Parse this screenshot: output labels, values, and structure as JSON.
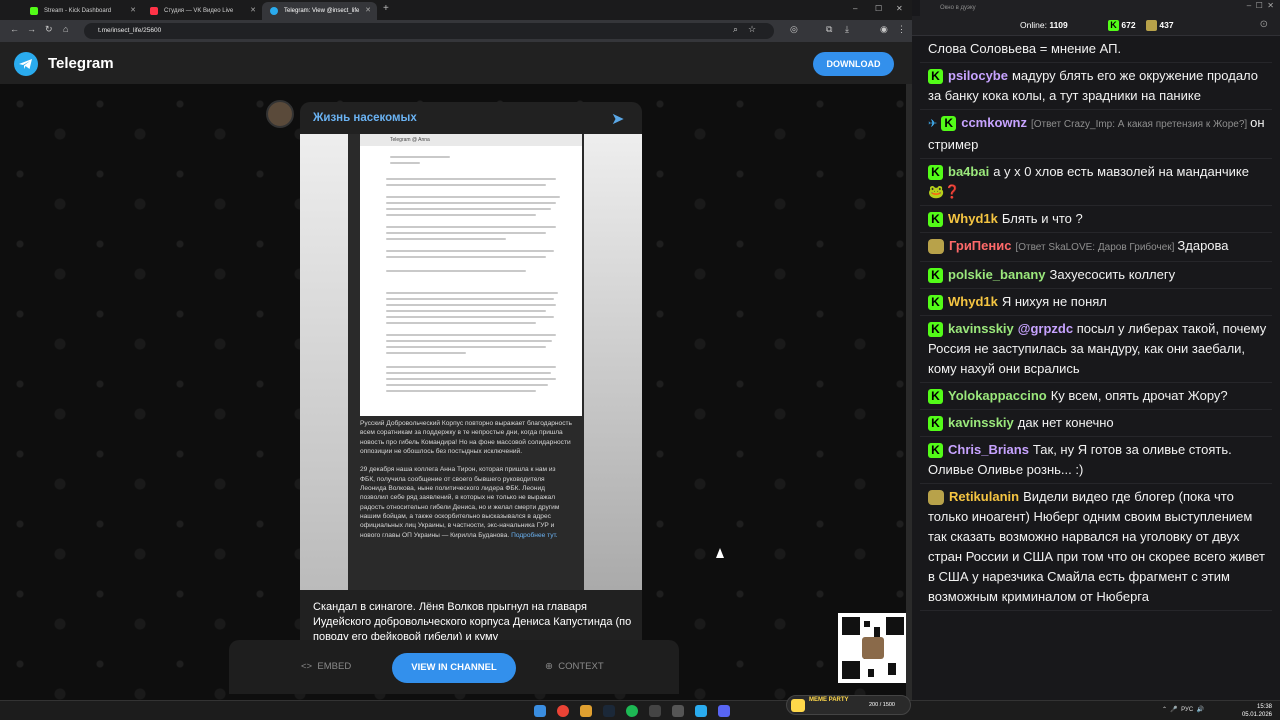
{
  "browser": {
    "tabs": [
      {
        "title": "Stream - Kick Dashboard",
        "favicon_color": "#53fc18"
      },
      {
        "title": "Студия — VK Видео Live",
        "favicon_color": "#ff3347"
      },
      {
        "title": "Telegram: View @insect_life",
        "favicon_color": "#2aabee"
      }
    ],
    "new_tab": "+",
    "url": "t.me/insect_life/25600"
  },
  "telegram": {
    "brand": "Telegram",
    "download": "DOWNLOAD",
    "channel_title": "Жизнь насекомых",
    "screenshot_header": "Telegram @ Anna",
    "caption_p1": "Русский Добровольческий Корпус повторно выражает благодарность всем соратникам за поддержку в те непростые дни, когда пришла новость про гибель Командира! Но на фоне массовой солидарности оппозиции не обошлось без постыдных исключений.",
    "caption_p2": "29 декабря наша коллега Анна Тирон, которая пришла к нам из ФБК, получила сообщение от своего бывшего руководителя Леонида Волкова, ныне политического лидера ФБК. Леонид позволил себе ряд заявлений, в которых не только не выражал радость относительно гибели Дениса, но и желал смерти другим нашим бойцам, а также оскорбительно высказывался в адрес официальных лиц Украины, в частности, экс-начальника ГУР и нового главы ОП Украины — Кирилла Буданова.",
    "caption_link": "Подробнее тут.",
    "post_text": "Скандал в синагоге. Лёня Волков прыгнул на главаря Иудейского добровольческого корпуса Дениса Капустиндa (по поводу его фейковой гибели) и куму",
    "embed": "EMBED",
    "view_in_channel": "VIEW IN CHANNEL",
    "context": "CONTEXT"
  },
  "chat": {
    "window_title": "Окно в дуэку",
    "online_label": "Online:",
    "online_count": "1109",
    "kick_count": "672",
    "gift_count": "437",
    "messages": [
      {
        "user": "",
        "color": "#ffffff",
        "text": "Слова Соловьева = мнение АП."
      },
      {
        "user": "psilocybe",
        "color": "#c7a3ff",
        "badge": "kick",
        "text": "мадуру блять его же окружение продало за банку кока колы, а тут зрадники на панике"
      },
      {
        "user": "ccmkownz",
        "color": "#c7a3ff",
        "badge": "kick",
        "pin": true,
        "reply": "[Ответ Crazy_Imp: А какая претензия к Жоре?]",
        "text": "он стример"
      },
      {
        "user": "ba4bai",
        "color": "#9be87c",
        "badge": "kick",
        "text": "а у х 0 хлов есть мавзолей на манданчике 🐸❓"
      },
      {
        "user": "Whyd1k",
        "color": "#f5c542",
        "badge": "kick",
        "text": "Блять и что ?"
      },
      {
        "user": "ГриПенис",
        "color": "#ff6a6a",
        "badge": "gift",
        "reply": "[Ответ SkaLOVE: Даров Грибочек]",
        "text": "Здарова"
      },
      {
        "user": "polskie_banany",
        "color": "#9be87c",
        "badge": "kick",
        "text": "Захуесосить коллегу"
      },
      {
        "user": "Whyd1k",
        "color": "#f5c542",
        "badge": "kick",
        "text": "Я нихуя не понял"
      },
      {
        "user": "kavinsskiy",
        "color": "#9be87c",
        "badge": "kick",
        "mention": "@grpzdc",
        "text": "посыл у либерах такой, почему Россия не заступилась за мандуру, как они заебали, кому нахуй они всрались"
      },
      {
        "user": "Yolokappaccino",
        "color": "#9be87c",
        "badge": "kick",
        "text": "Ку всем, опять дрочат Жору?"
      },
      {
        "user": "kavinsskiy",
        "color": "#9be87c",
        "badge": "kick",
        "text": "дак нет конечно"
      },
      {
        "user": "Chris_Brians",
        "color": "#c7a3ff",
        "badge": "kick",
        "text": "Так, ну Я готов за оливье стоять. Оливье Оливье рознь... :)"
      },
      {
        "user": "Retikulanin",
        "color": "#f5c542",
        "badge": "gift",
        "text": "Видели видео где блогер (пока что только иноагент) Нюберг одним своим выступлением так сказать возможно нарвался на уголовку от двух стран  России и США при том что он скорее всего живет в США у нарезчика Смайла есть фрагмент с этим возможным криминалом от Нюберга"
      }
    ]
  },
  "overlay": {
    "meme_label": "MEME PARTY",
    "meme_progress": "200 / 1500"
  },
  "taskbar": {
    "lang": "РУС",
    "time": "15:38",
    "date": "05.01.2026"
  }
}
